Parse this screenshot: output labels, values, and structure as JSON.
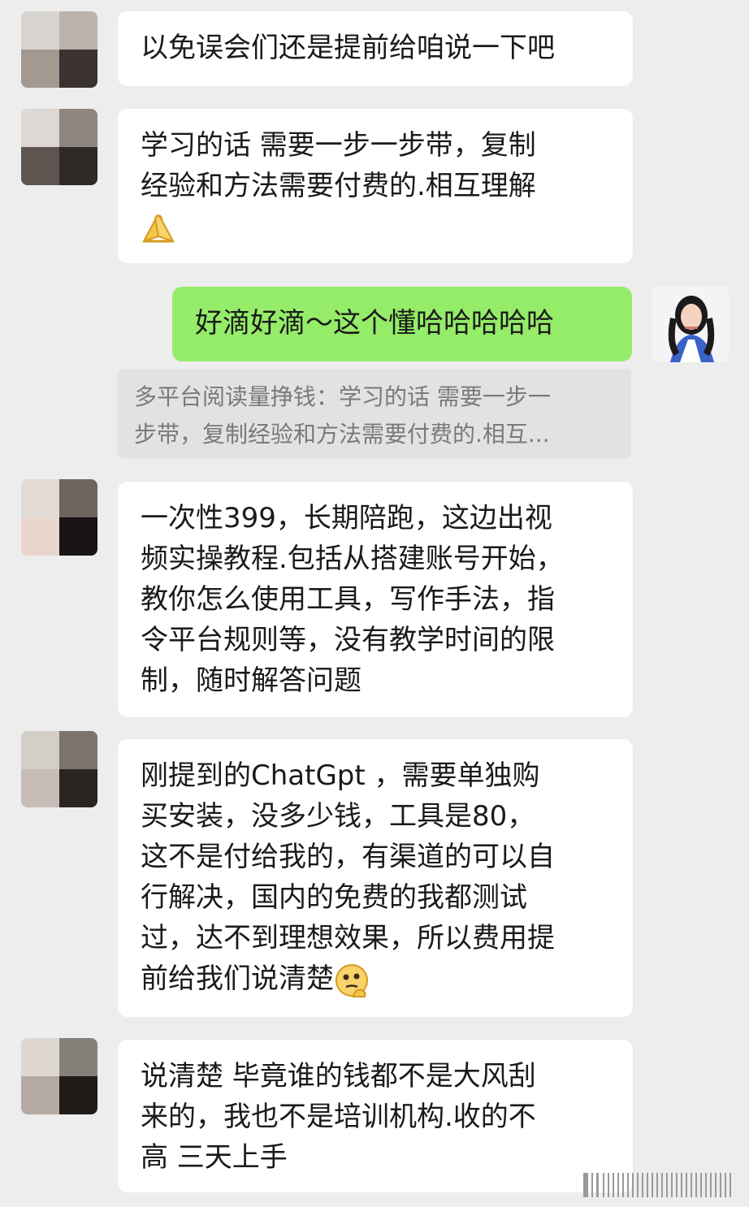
{
  "chat": {
    "messages": [
      {
        "from": "other",
        "lines": [
          "以免误会们还是提前给咱说一下吧"
        ]
      },
      {
        "from": "other",
        "lines": [
          " 学习的话 需要一步一步带，复制",
          "经验和方法需要付费的.相互理解"
        ],
        "emoji": "pray-hands-icon"
      },
      {
        "from": "self",
        "lines": [
          "好滴好滴～这个懂哈哈哈哈哈"
        ]
      },
      {
        "from": "quote",
        "lines": [
          "多平台阅读量挣钱：学习的话 需要一步一",
          "步带，复制经验和方法需要付费的.相互..."
        ]
      },
      {
        "from": "other",
        "lines": [
          "一次性399，长期陪跑，这边出视",
          "频实操教程.包括从搭建账号开始，",
          "教你怎么使用工具，写作手法，指",
          "令平台规则等，没有教学时间的限",
          "制，随时解答问题"
        ]
      },
      {
        "from": "other",
        "lines": [
          "刚提到的ChatGpt ，需要单独购",
          "买安装，没多少钱，工具是80，",
          "这不是付给我的，有渠道的可以自",
          "行解决，国内的免费的我都测试",
          "过，达不到理想效果，所以费用提",
          "前给我们说清楚"
        ],
        "emoji": "thinking-face-icon"
      },
      {
        "from": "other",
        "lines": [
          "说清楚 毕竟谁的钱都不是大风刮",
          "来的，我也不是培训机构.收的不",
          "高 三天上手"
        ]
      }
    ]
  },
  "colors": {
    "background": "#ededed",
    "incoming_bubble": "#ffffff",
    "outgoing_bubble": "#95ec69",
    "quote_bg": "#e2e2e2"
  }
}
